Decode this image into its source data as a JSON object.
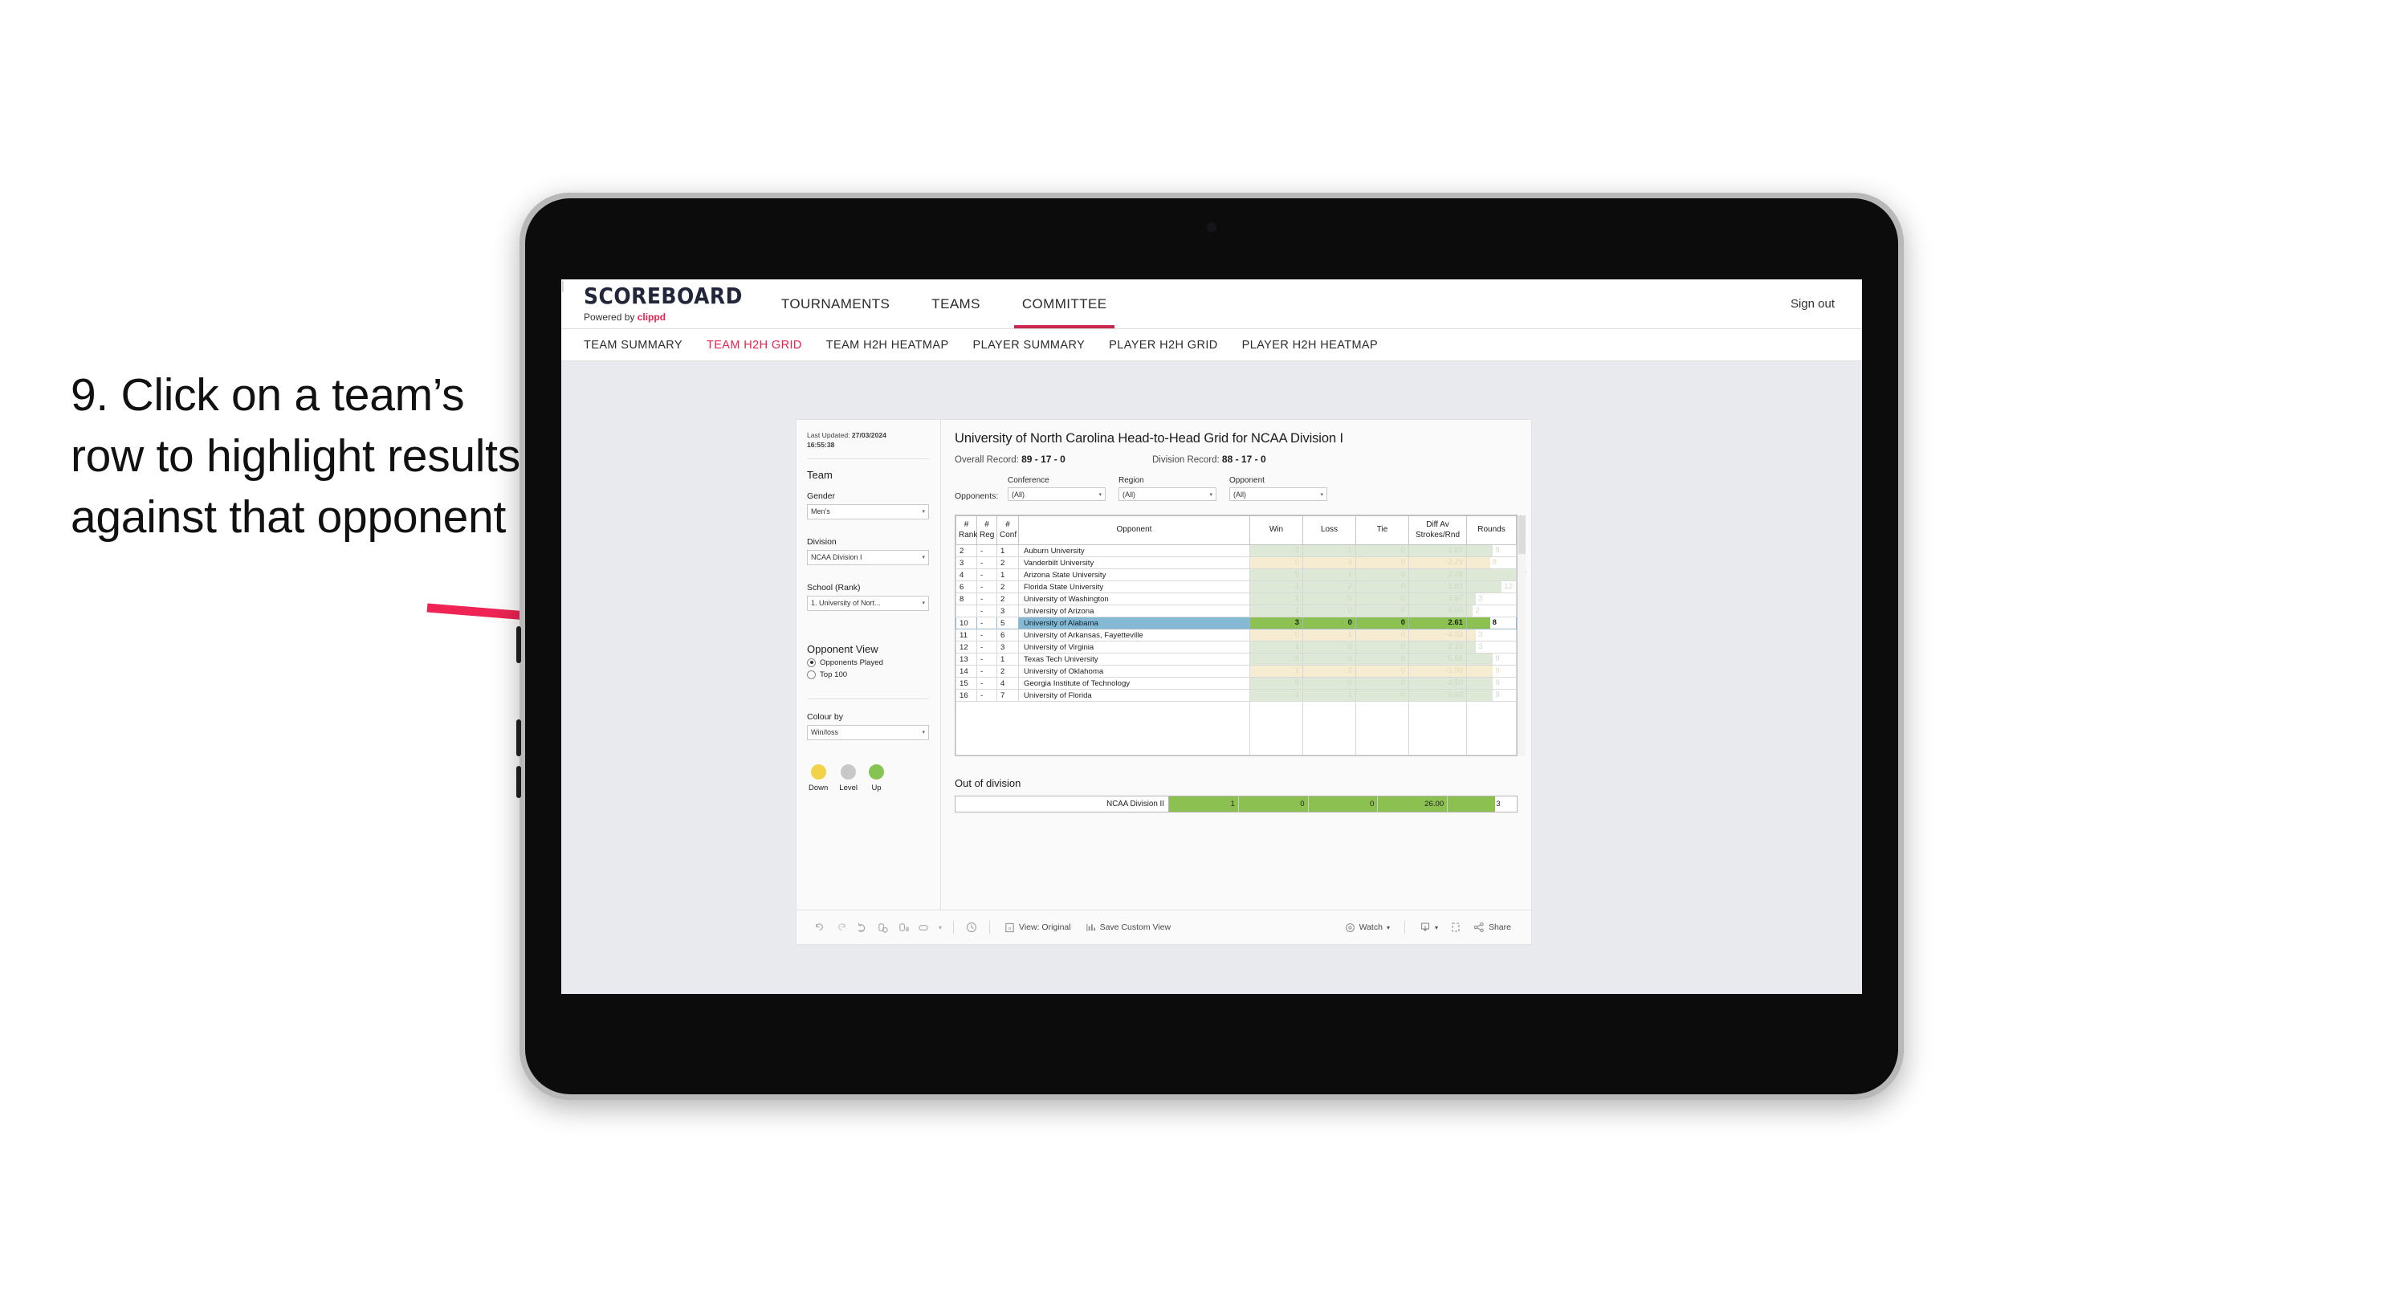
{
  "annotation": {
    "text": "9. Click on a team’s row to highlight results against that opponent",
    "arrow_color": "#ef2455"
  },
  "header": {
    "brand_name": "SCOREBOARD",
    "brand_sub_prefix": "Powered by ",
    "brand_sub_accent": "clippd",
    "nav": [
      {
        "label": "TOURNAMENTS",
        "active": false
      },
      {
        "label": "TEAMS",
        "active": false
      },
      {
        "label": "COMMITTEE",
        "active": true
      }
    ],
    "divider": "|",
    "sign_out": "Sign out",
    "accent_color": "#e8204e"
  },
  "subnav": [
    {
      "label": "TEAM SUMMARY",
      "active": false
    },
    {
      "label": "TEAM H2H GRID",
      "active": true
    },
    {
      "label": "TEAM H2H HEATMAP",
      "active": false
    },
    {
      "label": "PLAYER SUMMARY",
      "active": false
    },
    {
      "label": "PLAYER H2H GRID",
      "active": false
    },
    {
      "label": "PLAYER H2H HEATMAP",
      "active": false
    }
  ],
  "sidebar": {
    "last_updated_label": "Last Updated: ",
    "last_updated_date": "27/03/2024",
    "last_updated_time": "16:55:38",
    "team_heading": "Team",
    "gender_label": "Gender",
    "gender_value": "Men’s",
    "division_label": "Division",
    "division_value": "NCAA Division I",
    "school_label": "School (Rank)",
    "school_value": "1. University of Nort...",
    "opponent_view_heading": "Opponent View",
    "opponent_view_options": [
      {
        "label": "Opponents Played",
        "selected": true
      },
      {
        "label": "Top 100",
        "selected": false
      }
    ],
    "colour_by_label": "Colour by",
    "colour_by_value": "Win/loss",
    "legend": [
      {
        "label": "Down",
        "color": "#f2d24b"
      },
      {
        "label": "Level",
        "color": "#c8c8c8"
      },
      {
        "label": "Up",
        "color": "#85c453"
      }
    ]
  },
  "main": {
    "title": "University of North Carolina Head-to-Head Grid for NCAA Division I",
    "overall_record_label": "Overall Record: ",
    "overall_record_value": "89 - 17 - 0",
    "division_record_label": "Division Record: ",
    "division_record_value": "88 - 17 - 0",
    "opponents_label": "Opponents:",
    "filters": [
      {
        "label": "Conference",
        "value": "(All)"
      },
      {
        "label": "Region",
        "value": "(All)"
      },
      {
        "label": "Opponent",
        "value": "(All)"
      }
    ]
  },
  "chart_data": {
    "type": "table",
    "title": "University of North Carolina Head-to-Head Grid for NCAA Division I",
    "columns": [
      "# Rank",
      "# Reg",
      "# Conf",
      "Opponent",
      "Win",
      "Loss",
      "Tie",
      "Diff Av Strokes/Rnd",
      "Rounds"
    ],
    "rows": [
      {
        "rank": "2",
        "reg": "-",
        "conf": "1",
        "opponent": "Auburn University",
        "win": 2,
        "loss": 1,
        "tie": 0,
        "diff": "1.67",
        "rounds": 9,
        "state": "up",
        "selected": false
      },
      {
        "rank": "3",
        "reg": "-",
        "conf": "2",
        "opponent": "Vanderbilt University",
        "win": 0,
        "loss": 4,
        "tie": 0,
        "diff": "-2.29",
        "rounds": 8,
        "state": "down",
        "selected": false
      },
      {
        "rank": "4",
        "reg": "-",
        "conf": "1",
        "opponent": "Arizona State University",
        "win": 5,
        "loss": 1,
        "tie": 0,
        "diff": "2.28",
        "rounds": 17,
        "state": "up",
        "selected": false
      },
      {
        "rank": "6",
        "reg": "-",
        "conf": "2",
        "opponent": "Florida State University",
        "win": 4,
        "loss": 2,
        "tie": 0,
        "diff": "1.83",
        "rounds": 12,
        "state": "up",
        "selected": false
      },
      {
        "rank": "8",
        "reg": "-",
        "conf": "2",
        "opponent": "University of Washington",
        "win": 1,
        "loss": 0,
        "tie": 0,
        "diff": "3.67",
        "rounds": 3,
        "state": "up",
        "selected": false
      },
      {
        "rank": "",
        "reg": "-",
        "conf": "3",
        "opponent": "University of Arizona",
        "win": 1,
        "loss": 0,
        "tie": 0,
        "diff": "9.00",
        "rounds": 2,
        "state": "up",
        "selected": false
      },
      {
        "rank": "10",
        "reg": "-",
        "conf": "5",
        "opponent": "University of Alabama",
        "win": 3,
        "loss": 0,
        "tie": 0,
        "diff": "2.61",
        "rounds": 8,
        "state": "up",
        "selected": true
      },
      {
        "rank": "11",
        "reg": "-",
        "conf": "6",
        "opponent": "University of Arkansas, Fayetteville",
        "win": 0,
        "loss": 1,
        "tie": 0,
        "diff": "-4.33",
        "rounds": 3,
        "state": "down",
        "selected": false
      },
      {
        "rank": "12",
        "reg": "-",
        "conf": "3",
        "opponent": "University of Virginia",
        "win": 1,
        "loss": 0,
        "tie": 0,
        "diff": "2.33",
        "rounds": 3,
        "state": "up",
        "selected": false
      },
      {
        "rank": "13",
        "reg": "-",
        "conf": "1",
        "opponent": "Texas Tech University",
        "win": 3,
        "loss": 0,
        "tie": 0,
        "diff": "5.56",
        "rounds": 9,
        "state": "up",
        "selected": false
      },
      {
        "rank": "14",
        "reg": "-",
        "conf": "2",
        "opponent": "University of Oklahoma",
        "win": 1,
        "loss": 2,
        "tie": 0,
        "diff": "-1.00",
        "rounds": 9,
        "state": "down",
        "selected": false
      },
      {
        "rank": "15",
        "reg": "-",
        "conf": "4",
        "opponent": "Georgia Institute of Technology",
        "win": 5,
        "loss": 0,
        "tie": 0,
        "diff": "4.50",
        "rounds": 9,
        "state": "up",
        "selected": false
      },
      {
        "rank": "16",
        "reg": "-",
        "conf": "7",
        "opponent": "University of Florida",
        "win": 3,
        "loss": 1,
        "tie": 0,
        "diff": "6.62",
        "rounds": 9,
        "state": "up",
        "selected": false
      }
    ],
    "colors": {
      "up": "#dde9d6",
      "down": "#f6ecd2",
      "selected": "#8cc152",
      "selected_row_label": "#85b8d3"
    }
  },
  "out_of_division": {
    "title": "Out of division",
    "row": {
      "label": "NCAA Division II",
      "win": "1",
      "loss": "0",
      "tie": "0",
      "diff": "26.00",
      "rounds": "3"
    },
    "fill_color": "#8cc152"
  },
  "toolbar": {
    "icons": [
      "undo-icon",
      "redo-icon",
      "revert-icon",
      "refresh-data-icon",
      "pause-updates-icon",
      "alerts-icon",
      "history-icon"
    ],
    "view_label": "View: Original",
    "save_view_label": "Save Custom View",
    "watch_label": "Watch",
    "share_label": "Share"
  }
}
